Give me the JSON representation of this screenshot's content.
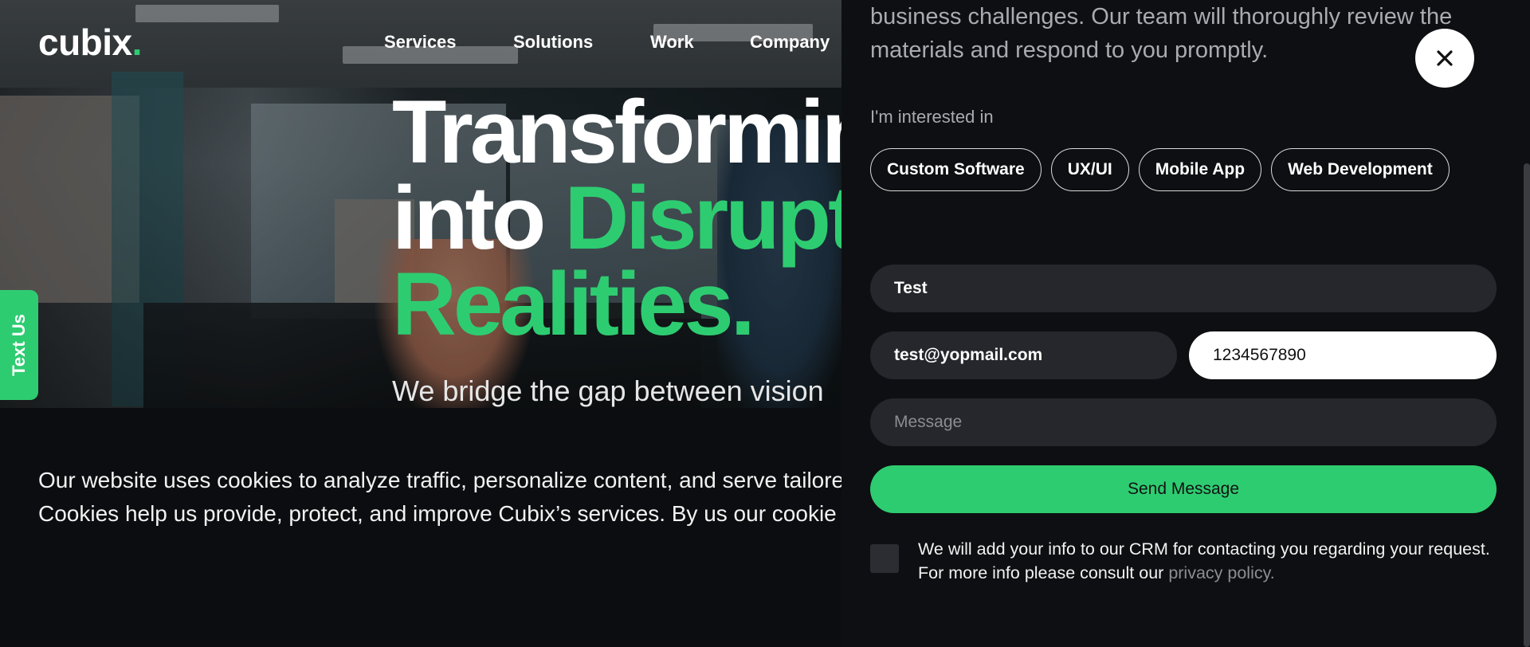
{
  "header": {
    "logo_text": "cubix",
    "logo_dot": ".",
    "nav": [
      "Services",
      "Solutions",
      "Work",
      "Company"
    ]
  },
  "hero": {
    "line1": "Transformin",
    "line2_white": "into",
    "line2_green": "Disrupt",
    "line3": "Realities.",
    "subtitle": "We bridge the gap between vision",
    "text_us": "Text Us"
  },
  "cookie": {
    "text": "Our website uses cookies to analyze traffic, personalize content, and serve tailore experiences. Cookies help us provide, protect, and improve Cubix’s services. By us our cookie policy."
  },
  "contact_panel": {
    "intro": "business challenges. Our team will thoroughly review the materials and respond to you promptly.",
    "interested_label": "I'm interested in",
    "chips": [
      "Custom Software",
      "UX/UI",
      "Mobile App",
      "Web Development"
    ],
    "name_value": "Test",
    "email_value": "test@yopmail.com",
    "phone_value": "1234567890",
    "message_placeholder": "Message",
    "send_label": "Send Message",
    "consent_text": "We will add your info to our CRM for contacting you regarding your request. For more info please consult our",
    "privacy_link": "privacy policy."
  },
  "colors": {
    "accent": "#2ecc71",
    "panel_bg": "#0e0f12",
    "field_bg": "#25272c"
  },
  "icons": {
    "close": "close-icon"
  }
}
